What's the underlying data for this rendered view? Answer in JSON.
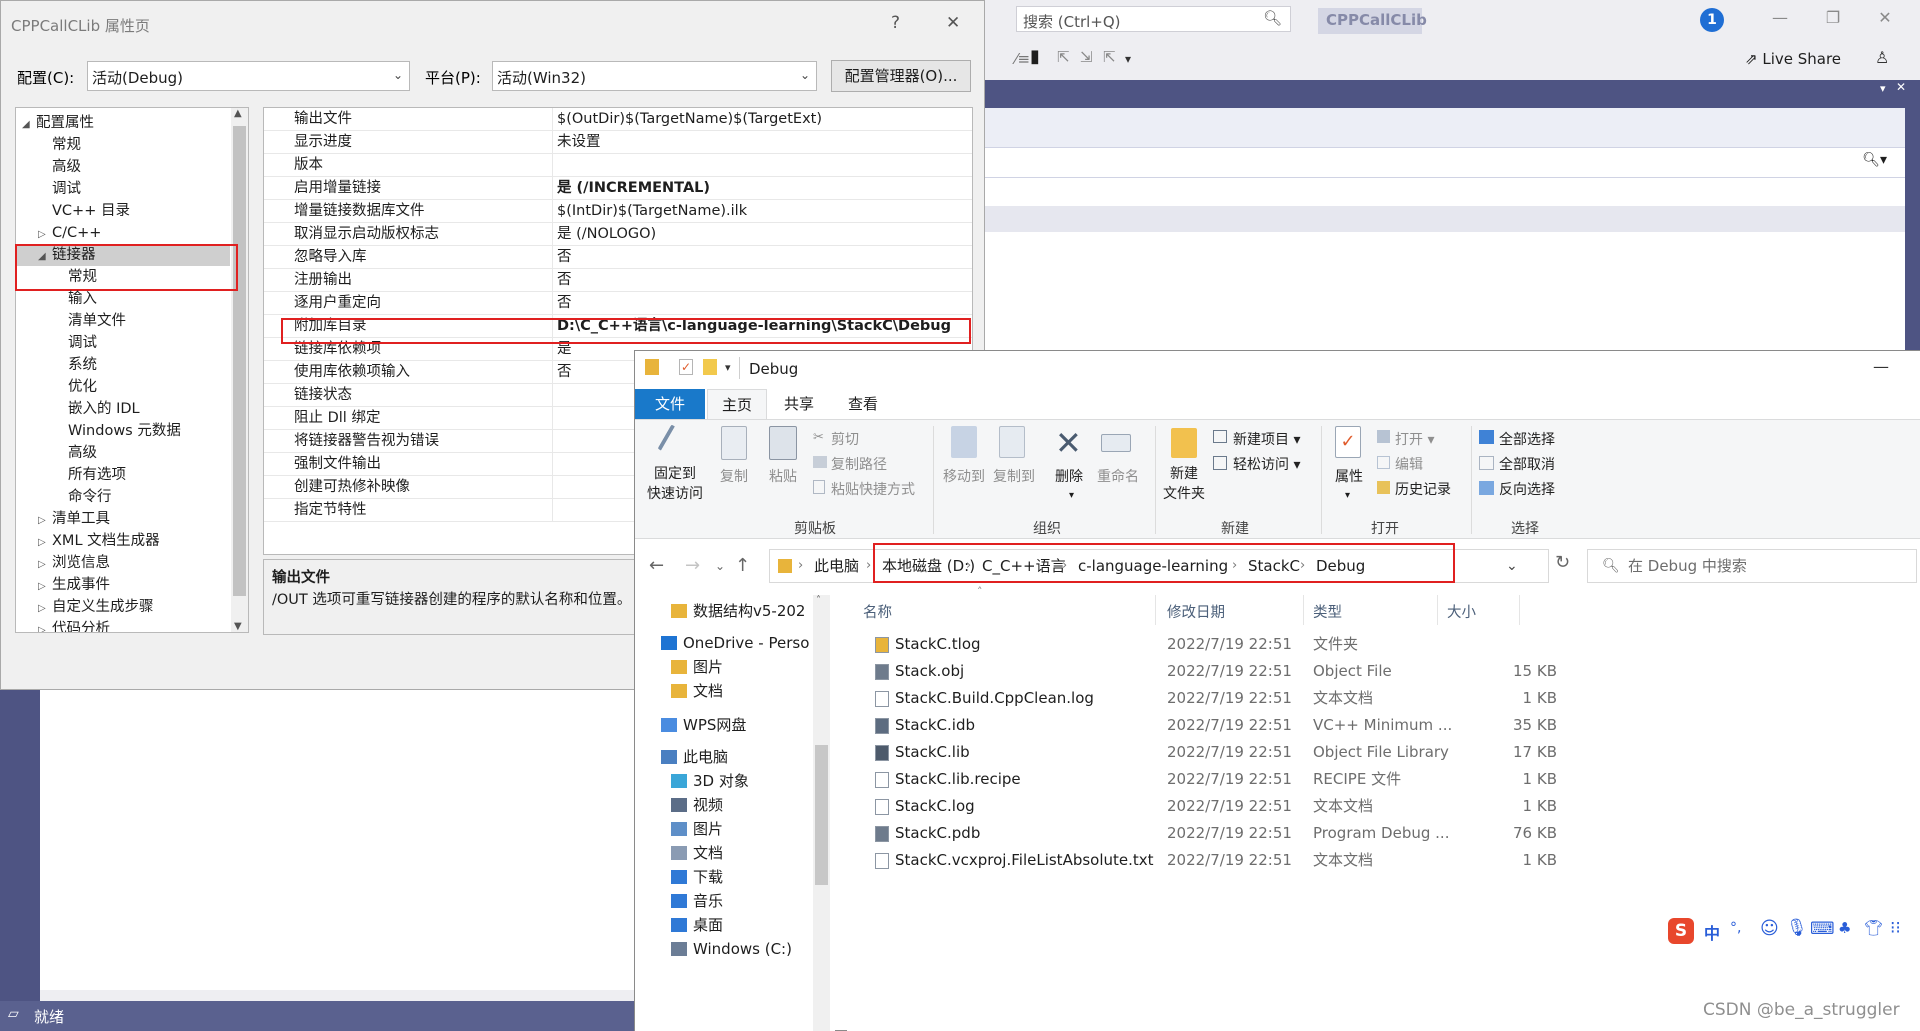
{
  "vs": {
    "search_placeholder": "搜索 (Ctrl+Q)",
    "project_name": "CPPCallCLib",
    "notification_count": "1",
    "live_share": "Live Share",
    "status_text": "就绪"
  },
  "dialog": {
    "title": "CPPCallCLib 属性页",
    "help": "?",
    "close": "✕",
    "config_label": "配置(C):",
    "config_value": "活动(Debug)",
    "platform_label": "平台(P):",
    "platform_value": "活动(Win32)",
    "config_manager": "配置管理器(O)...",
    "tree": [
      {
        "label": "配置属性",
        "expander": "◢",
        "level": 0
      },
      {
        "label": "常规",
        "expander": "",
        "level": 1
      },
      {
        "label": "高级",
        "expander": "",
        "level": 1
      },
      {
        "label": "调试",
        "expander": "",
        "level": 1
      },
      {
        "label": "VC++ 目录",
        "expander": "",
        "level": 1
      },
      {
        "label": "C/C++",
        "expander": "▷",
        "level": 1
      },
      {
        "label": "链接器",
        "expander": "◢",
        "level": 1
      },
      {
        "label": "常规",
        "expander": "",
        "level": 2
      },
      {
        "label": "输入",
        "expander": "",
        "level": 2
      },
      {
        "label": "清单文件",
        "expander": "",
        "level": 2
      },
      {
        "label": "调试",
        "expander": "",
        "level": 2
      },
      {
        "label": "系统",
        "expander": "",
        "level": 2
      },
      {
        "label": "优化",
        "expander": "",
        "level": 2
      },
      {
        "label": "嵌入的 IDL",
        "expander": "",
        "level": 2
      },
      {
        "label": "Windows 元数据",
        "expander": "",
        "level": 2
      },
      {
        "label": "高级",
        "expander": "",
        "level": 2
      },
      {
        "label": "所有选项",
        "expander": "",
        "level": 2
      },
      {
        "label": "命令行",
        "expander": "",
        "level": 2
      },
      {
        "label": "清单工具",
        "expander": "▷",
        "level": 1
      },
      {
        "label": "XML 文档生成器",
        "expander": "▷",
        "level": 1
      },
      {
        "label": "浏览信息",
        "expander": "▷",
        "level": 1
      },
      {
        "label": "生成事件",
        "expander": "▷",
        "level": 1
      },
      {
        "label": "自定义生成步骤",
        "expander": "▷",
        "level": 1
      },
      {
        "label": "代码分析",
        "expander": "▷",
        "level": 1
      }
    ],
    "properties": [
      {
        "name": "输出文件",
        "value": "$(OutDir)$(TargetName)$(TargetExt)",
        "bold": false
      },
      {
        "name": "显示进度",
        "value": "未设置",
        "bold": false
      },
      {
        "name": "版本",
        "value": "",
        "bold": false
      },
      {
        "name": "启用增量链接",
        "value": "是 (/INCREMENTAL)",
        "bold": true
      },
      {
        "name": "增量链接数据库文件",
        "value": "$(IntDir)$(TargetName).ilk",
        "bold": false
      },
      {
        "name": "取消显示启动版权标志",
        "value": "是 (/NOLOGO)",
        "bold": false
      },
      {
        "name": "忽略导入库",
        "value": "否",
        "bold": false
      },
      {
        "name": "注册输出",
        "value": "否",
        "bold": false
      },
      {
        "name": "逐用户重定向",
        "value": "否",
        "bold": false
      },
      {
        "name": "附加库目录",
        "value": "D:\\C_C++语言\\c-language-learning\\StackC\\Debug",
        "bold": true
      },
      {
        "name": "链接库依赖项",
        "value": "是",
        "bold": false
      },
      {
        "name": "使用库依赖项输入",
        "value": "否",
        "bold": false
      },
      {
        "name": "链接状态",
        "value": "",
        "bold": false
      },
      {
        "name": "阻止 Dll 绑定",
        "value": "",
        "bold": false
      },
      {
        "name": "将链接器警告视为错误",
        "value": "",
        "bold": false
      },
      {
        "name": "强制文件输出",
        "value": "",
        "bold": false
      },
      {
        "name": "创建可热修补映像",
        "value": "",
        "bold": false
      },
      {
        "name": "指定节特性",
        "value": "",
        "bold": false
      }
    ],
    "desc_title": "输出文件",
    "desc_text": "/OUT 选项可重写链接器创建的程序的默认名称和位置。"
  },
  "explorer": {
    "title": "Debug",
    "tabs": [
      "文件",
      "主页",
      "共享",
      "查看"
    ],
    "ribbon": {
      "pin": "固定到\n快速访问",
      "copy": "复制",
      "paste": "粘贴",
      "cut": "剪切",
      "copy_path": "复制路径",
      "paste_shortcut": "粘贴快捷方式",
      "move_to": "移动到",
      "copy_to": "复制到",
      "delete": "删除",
      "rename": "重命名",
      "new_folder": "新建\n文件夹",
      "new_item": "新建项目",
      "easy_access": "轻松访问",
      "properties": "属性",
      "open": "打开",
      "edit": "编辑",
      "history": "历史记录",
      "select_all": "全部选择",
      "select_none": "全部取消",
      "invert": "反向选择",
      "groups": [
        "剪贴板",
        "组织",
        "新建",
        "打开",
        "选择"
      ]
    },
    "breadcrumbs": [
      "此电脑",
      "本地磁盘 (D:)",
      "C_C++语言",
      "c-language-learning",
      "StackC",
      "Debug"
    ],
    "search_placeholder": "在 Debug 中搜索",
    "nav": [
      {
        "label": "数据结构v5-202",
        "icon": "folder-icon",
        "indent": 1
      },
      {
        "label": "OneDrive - Perso",
        "icon": "onedrive-icon",
        "indent": 0
      },
      {
        "label": "图片",
        "icon": "folder-icon",
        "indent": 1
      },
      {
        "label": "文档",
        "icon": "folder-icon",
        "indent": 1
      },
      {
        "label": "WPS网盘",
        "icon": "wps-cloud-icon",
        "indent": 0
      },
      {
        "label": "此电脑",
        "icon": "pc-icon",
        "indent": 0
      },
      {
        "label": "3D 对象",
        "icon": "3d-objects-icon",
        "indent": 1
      },
      {
        "label": "视频",
        "icon": "video-icon",
        "indent": 1
      },
      {
        "label": "图片",
        "icon": "pictures-icon",
        "indent": 1
      },
      {
        "label": "文档",
        "icon": "documents-icon",
        "indent": 1
      },
      {
        "label": "下载",
        "icon": "download-icon",
        "indent": 1
      },
      {
        "label": "音乐",
        "icon": "music-icon",
        "indent": 1
      },
      {
        "label": "桌面",
        "icon": "desktop-icon",
        "indent": 1
      },
      {
        "label": "Windows (C:)",
        "icon": "drive-icon",
        "indent": 1
      }
    ],
    "columns": [
      "名称",
      "修改日期",
      "类型",
      "大小"
    ],
    "files": [
      {
        "name": "StackC.tlog",
        "date": "2022/7/19 22:51",
        "type": "文件夹",
        "size": "",
        "icon": "folder-icon"
      },
      {
        "name": "Stack.obj",
        "date": "2022/7/19 22:51",
        "type": "Object File",
        "size": "15 KB",
        "icon": "obj-file-icon"
      },
      {
        "name": "StackC.Build.CppClean.log",
        "date": "2022/7/19 22:51",
        "type": "文本文档",
        "size": "1 KB",
        "icon": "text-file-icon"
      },
      {
        "name": "StackC.idb",
        "date": "2022/7/19 22:51",
        "type": "VC++ Minimum ...",
        "size": "35 KB",
        "icon": "idb-file-icon"
      },
      {
        "name": "StackC.lib",
        "date": "2022/7/19 22:51",
        "type": "Object File Library",
        "size": "17 KB",
        "icon": "lib-file-icon"
      },
      {
        "name": "StackC.lib.recipe",
        "date": "2022/7/19 22:51",
        "type": "RECIPE 文件",
        "size": "1 KB",
        "icon": "generic-file-icon"
      },
      {
        "name": "StackC.log",
        "date": "2022/7/19 22:51",
        "type": "文本文档",
        "size": "1 KB",
        "icon": "text-file-icon"
      },
      {
        "name": "StackC.pdb",
        "date": "2022/7/19 22:51",
        "type": "Program Debug ...",
        "size": "76 KB",
        "icon": "pdb-file-icon"
      },
      {
        "name": "StackC.vcxproj.FileListAbsolute.txt",
        "date": "2022/7/19 22:51",
        "type": "文本文档",
        "size": "1 KB",
        "icon": "text-file-icon"
      }
    ]
  },
  "ime": {
    "lang": "中",
    "punct": "°,"
  },
  "watermark": "CSDN @be_a_struggler"
}
